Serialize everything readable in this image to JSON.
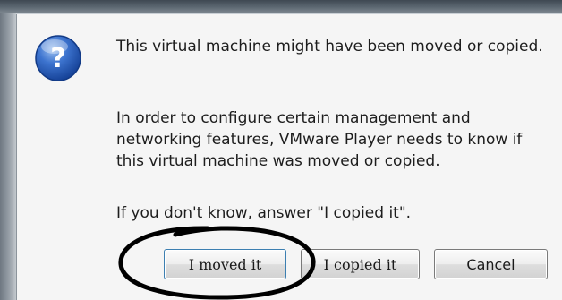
{
  "dialog": {
    "icon": "question-icon",
    "message_lines": [
      "This virtual machine might have been moved or copied.",
      "In order to configure certain management and networking features, VMware Player needs to know if this virtual machine was moved or copied.",
      "If you don't know, answer \"I copied it\"."
    ]
  },
  "buttons": {
    "moved": "I moved it",
    "copied": "I copied it",
    "cancel": "Cancel"
  },
  "colors": {
    "icon_blue": "#2b5fb8",
    "annotation_ink": "#000000",
    "default_button_border": "#3c7fb1"
  },
  "annotation": {
    "shape": "hand-drawn-ellipse",
    "highlights": "I moved it"
  }
}
